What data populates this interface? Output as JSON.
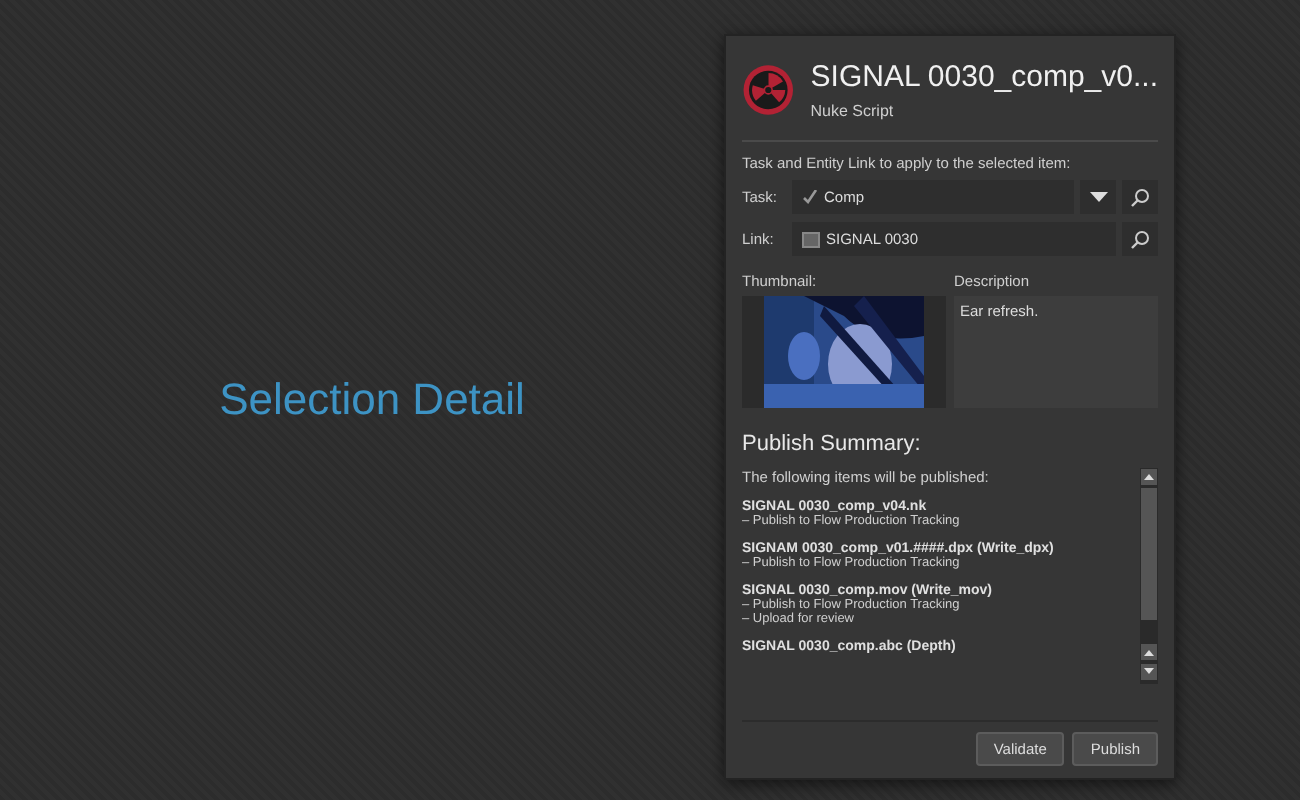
{
  "heading": "Selection Detail",
  "item": {
    "title": "SIGNAL 0030_comp_v0...",
    "subtitle": "Nuke Script"
  },
  "context": {
    "prompt": "Task and Entity Link to apply to the selected item:",
    "task": {
      "label": "Task:",
      "value": "Comp"
    },
    "link": {
      "label": "Link:",
      "value": "SIGNAL 0030"
    }
  },
  "thumbnail": {
    "label": "Thumbnail:",
    "kind": "picture"
  },
  "description": {
    "label": "Description",
    "value": "Ear refresh."
  },
  "summary": {
    "title": "Publish Summary:",
    "intro": "The following items will be published:",
    "items": [
      {
        "name": "SIGNAL 0030_comp_v04.nk",
        "actions": [
          "– Publish to Flow Production Tracking"
        ]
      },
      {
        "name": "SIGNAM 0030_comp_v01.####.dpx (Write_dpx)",
        "actions": [
          "– Publish to Flow Production Tracking"
        ]
      },
      {
        "name": "SIGNAL 0030_comp.mov (Write_mov)",
        "actions": [
          "– Publish to Flow Production Tracking",
          "– Upload for review"
        ]
      },
      {
        "name": "SIGNAL 0030_comp.abc (Depth)"
      }
    ]
  },
  "buttons": [
    {
      "label": "Validate"
    },
    {
      "label": "Publish"
    }
  ]
}
